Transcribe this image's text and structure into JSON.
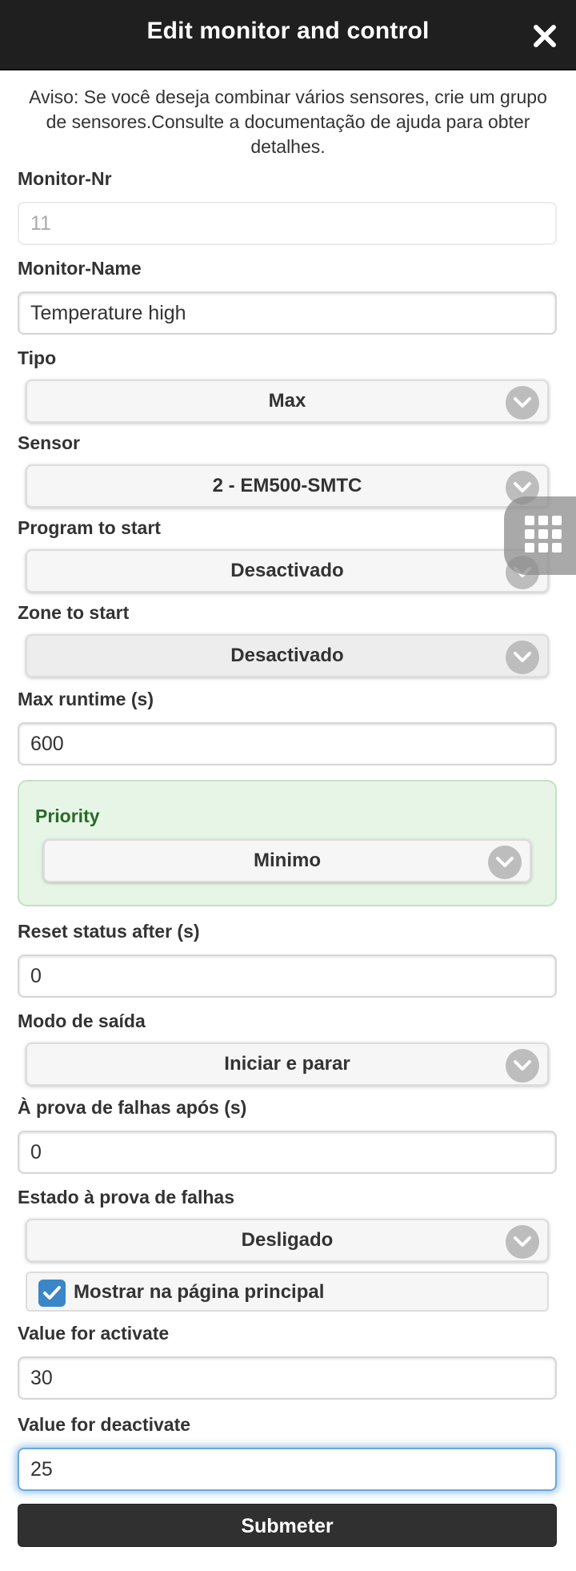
{
  "header": {
    "title": "Edit monitor and control"
  },
  "notice": "Aviso: Se você deseja combinar vários sensores, crie um grupo de sensores.Consulte a documentação de ajuda para obter detalhes.",
  "fields": {
    "monitor_nr": {
      "label": "Monitor-Nr",
      "value": "11"
    },
    "monitor_name": {
      "label": "Monitor-Name",
      "value": "Temperature high"
    },
    "tipo": {
      "label": "Tipo",
      "value": "Max"
    },
    "sensor": {
      "label": "Sensor",
      "value": "2 - EM500-SMTC"
    },
    "program": {
      "label": "Program to start",
      "value": "Desactivado"
    },
    "zone": {
      "label": "Zone to start",
      "value": "Desactivado"
    },
    "max_runtime": {
      "label": "Max runtime (s)",
      "value": "600"
    },
    "priority": {
      "label": "Priority",
      "value": "Minimo"
    },
    "reset_status": {
      "label": "Reset status after (s)",
      "value": "0"
    },
    "output_mode": {
      "label": "Modo de saída",
      "value": "Iniciar e parar"
    },
    "failsafe_after": {
      "label": "À prova de falhas após (s)",
      "value": "0"
    },
    "failsafe_state": {
      "label": "Estado à prova de falhas",
      "value": "Desligado"
    },
    "show_main": {
      "label": "Mostrar na página principal",
      "checked": true
    },
    "value_activate": {
      "label": "Value for activate",
      "value": "30"
    },
    "value_deactivate": {
      "label": "Value for deactivate",
      "value": "25"
    }
  },
  "submit_label": "Submeter",
  "colors": {
    "header_bg": "#1f1f1f",
    "priority_bg": "#e7f5e7",
    "priority_label": "#2a6a2a",
    "checkbox": "#3a86c8",
    "submit_bg": "#303030",
    "focus_glow": "#388cd2"
  },
  "icons": [
    "close-icon",
    "chevron-down-icon",
    "check-icon",
    "grid-icon"
  ]
}
